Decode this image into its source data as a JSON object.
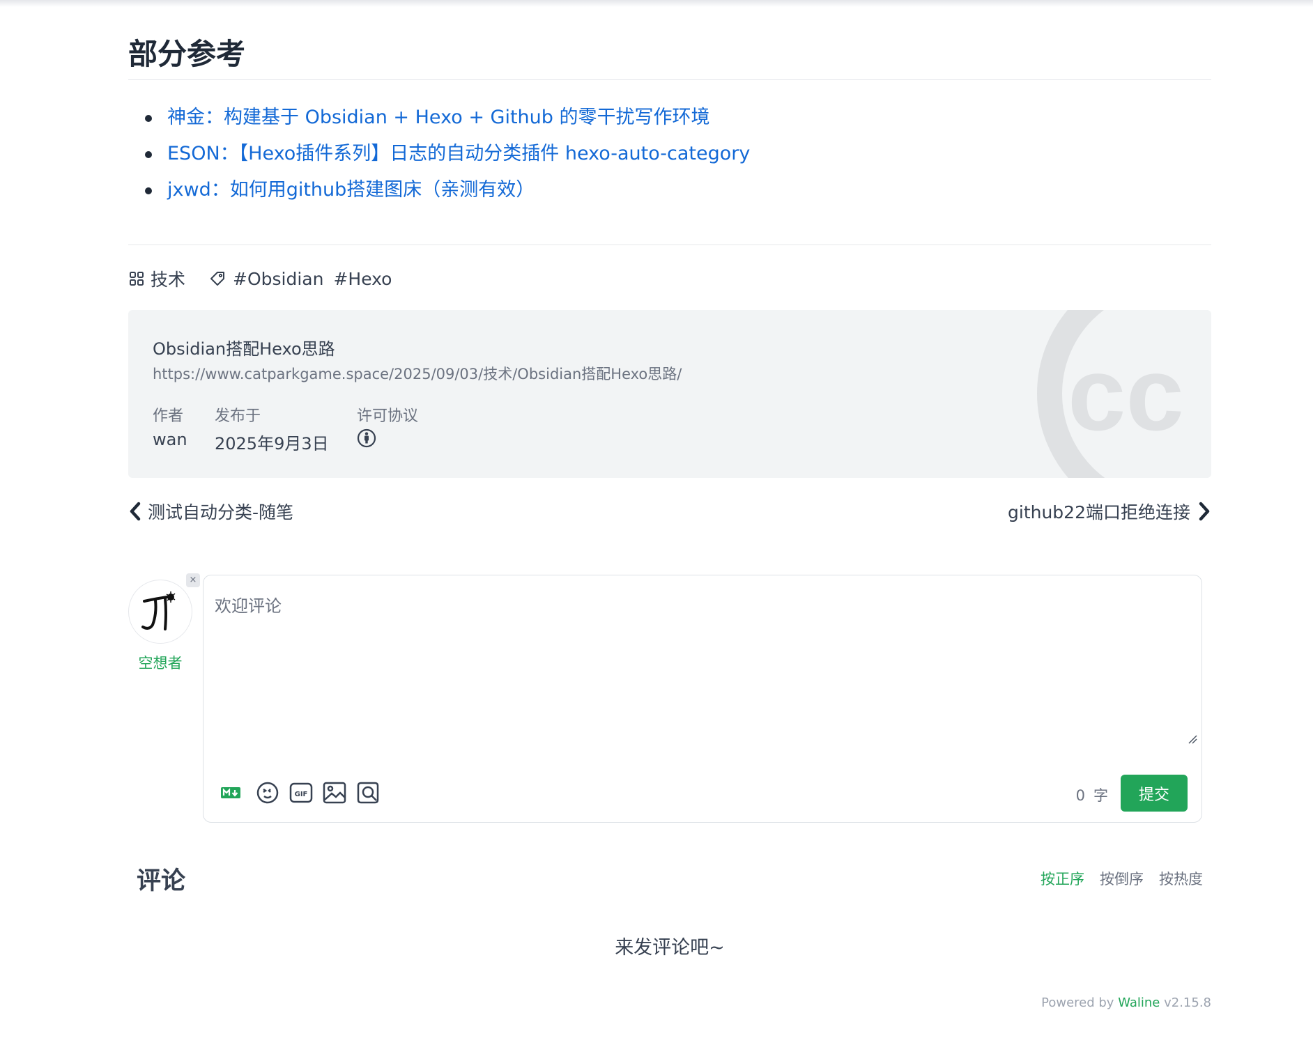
{
  "section": {
    "title": "部分参考"
  },
  "references": [
    {
      "label": "神金：构建基于 Obsidian + Hexo + Github 的零干扰写作环境"
    },
    {
      "label": "ESON：【Hexo插件系列】日志的自动分类插件 hexo-auto-category"
    },
    {
      "label": "jxwd：如何用github搭建图床（亲测有效）"
    }
  ],
  "post_meta": {
    "category": "技术",
    "category_icon": "category-grid-icon",
    "tag_icon": "tag-icon",
    "tags": [
      "#Obsidian",
      "#Hexo"
    ]
  },
  "license": {
    "title": "Obsidian搭配Hexo思路",
    "url": "https://www.catparkgame.space/2025/09/03/技术/Obsidian搭配Hexo思路/",
    "author_label": "作者",
    "author": "wan",
    "date_label": "发布于",
    "date": "2025年9月3日",
    "license_label": "许可协议",
    "license_icon": "cc-by-icon"
  },
  "post_nav": {
    "prev": "测试自动分类-随笔",
    "next": "github22端口拒绝连接"
  },
  "comment_form": {
    "nickname": "空想者",
    "placeholder": "欢迎评论",
    "word_count": "0",
    "word_unit": "字",
    "submit_label": "提交",
    "close_symbol": "×",
    "tools": [
      "markdown-icon",
      "emoji-icon",
      "gif-icon",
      "image-icon",
      "preview-icon"
    ]
  },
  "comments": {
    "title": "评论",
    "sort_options": [
      "按正序",
      "按倒序",
      "按热度"
    ],
    "active_sort": "按正序",
    "empty_text": "来发评论吧~"
  },
  "footer": {
    "powered_by": "Powered by",
    "brand": "Waline",
    "version": "v2.15.8"
  },
  "colors": {
    "link": "#1369d6",
    "accent": "#22a559",
    "license_bg": "#f2f4f5"
  }
}
